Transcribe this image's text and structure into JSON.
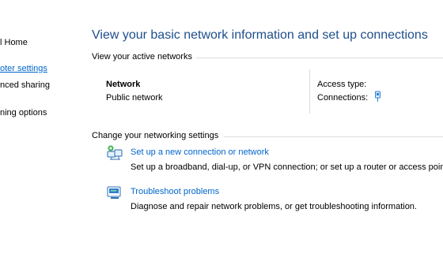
{
  "left_pane": {
    "items": [
      {
        "label": "l Home"
      },
      {
        "label": "oter settings"
      },
      {
        "label": "nced sharing"
      },
      {
        "label": "ning options"
      }
    ]
  },
  "main": {
    "title": "View your basic network information and set up connections",
    "active_networks": {
      "section_title": "View your active networks",
      "network_name": "Network",
      "network_type": "Public network",
      "access_type_label": "Access type:",
      "connections_label": "Connections:"
    },
    "change_settings": {
      "section_title": "Change your networking settings",
      "tasks": [
        {
          "icon": "network-setup-icon",
          "link": "Set up a new connection or network",
          "description": "Set up a broadband, dial-up, or VPN connection; or set up a router or access point."
        },
        {
          "icon": "troubleshoot-icon",
          "link": "Troubleshoot problems",
          "description": "Diagnose and repair network problems, or get troubleshooting information."
        }
      ]
    }
  },
  "colors": {
    "title": "#1e4e8c",
    "link": "#0066cc",
    "rule": "#dcdcdc"
  }
}
